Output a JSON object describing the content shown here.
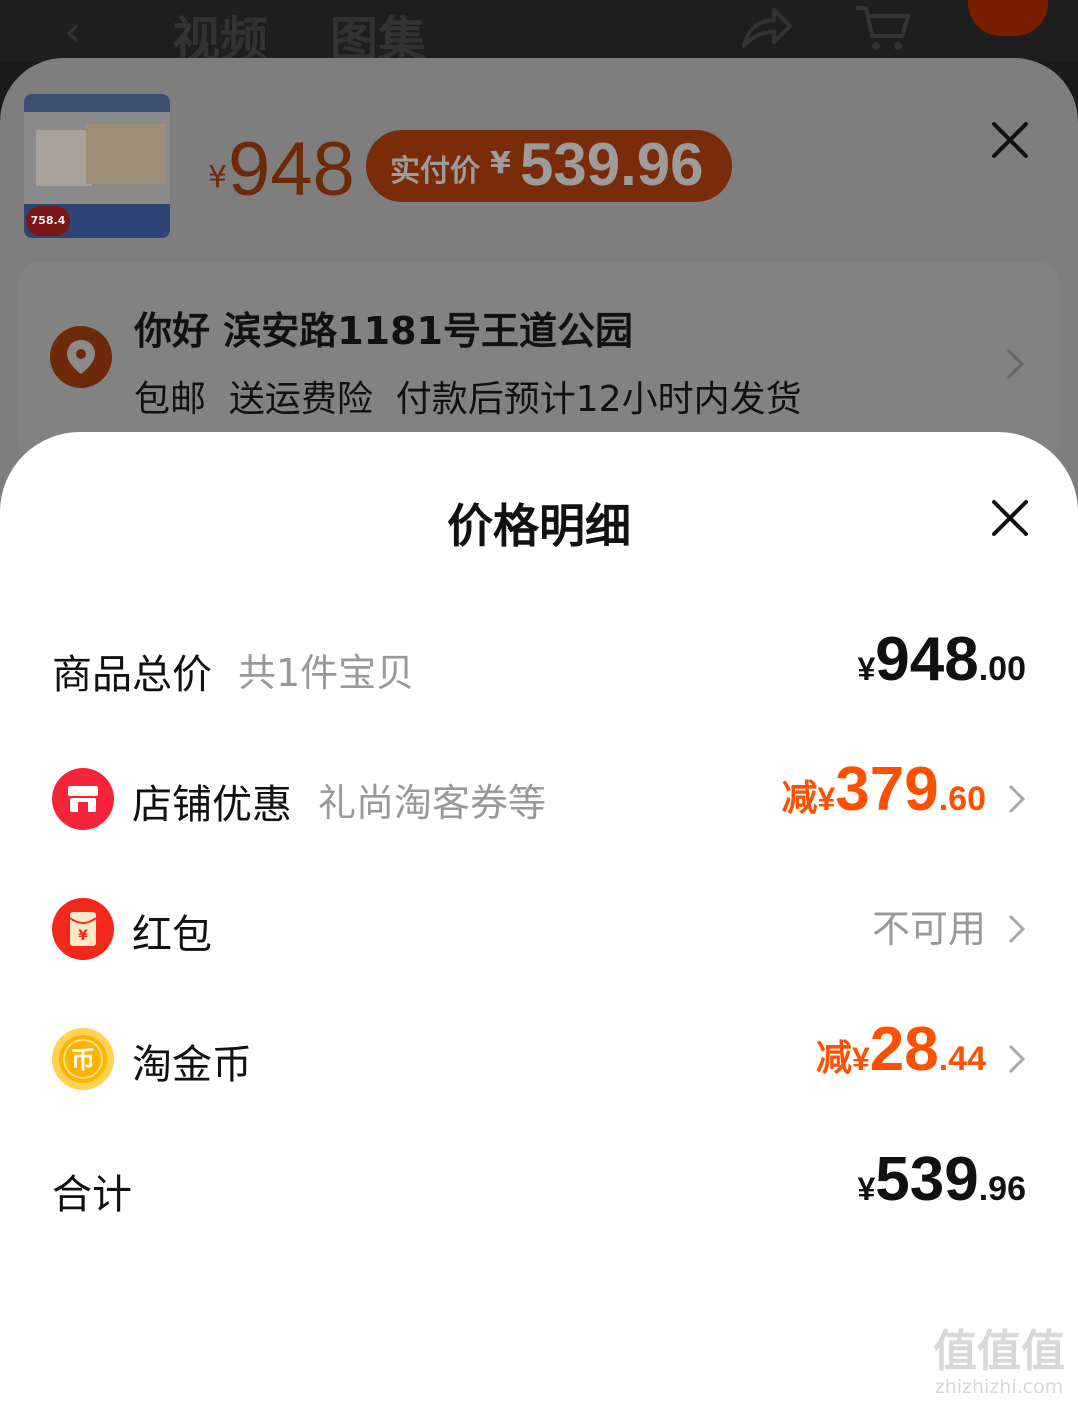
{
  "top_bar": {
    "tabs": [
      "视频",
      "图集"
    ]
  },
  "sku_panel": {
    "thumbnail_promo_price": "758.4",
    "currency": "¥",
    "original_price": "948",
    "pay_label": "实付价",
    "pay_currency": "¥",
    "pay_price": "539.96",
    "address": {
      "title": "你好 滨安路1181号王道公园",
      "subtitle": "包邮  送运费险  付款后预计12小时内发货"
    }
  },
  "price_detail": {
    "title": "价格明细",
    "rows": [
      {
        "label": "商品总价",
        "sub": "共1件宝贝",
        "prefix": "",
        "currency": "¥",
        "integer": "948",
        "decimal": ".00",
        "style": "black"
      },
      {
        "label": "店铺优惠",
        "sub": "礼尚淘客券等",
        "prefix": "减",
        "currency": "¥",
        "integer": "379",
        "decimal": ".60",
        "style": "orange",
        "icon": "shop-icon"
      },
      {
        "label": "红包",
        "status": "不可用",
        "icon": "red-envelope-icon"
      },
      {
        "label": "淘金币",
        "prefix": "减",
        "currency": "¥",
        "integer": "28",
        "decimal": ".44",
        "style": "orange",
        "icon": "coin-icon",
        "coin_glyph": "币"
      },
      {
        "label": "合计",
        "prefix": "",
        "currency": "¥",
        "integer": "539",
        "decimal": ".96",
        "style": "black"
      }
    ],
    "envelope_glyph": "¥"
  },
  "watermark": {
    "mark": "值值值",
    "url": "zhizhizhi.com"
  },
  "colors": {
    "accent_orange": "#ff5000",
    "shop_red": "#f5243a",
    "envelope_red": "#f1281a",
    "coin_gold": "#ffb300"
  }
}
